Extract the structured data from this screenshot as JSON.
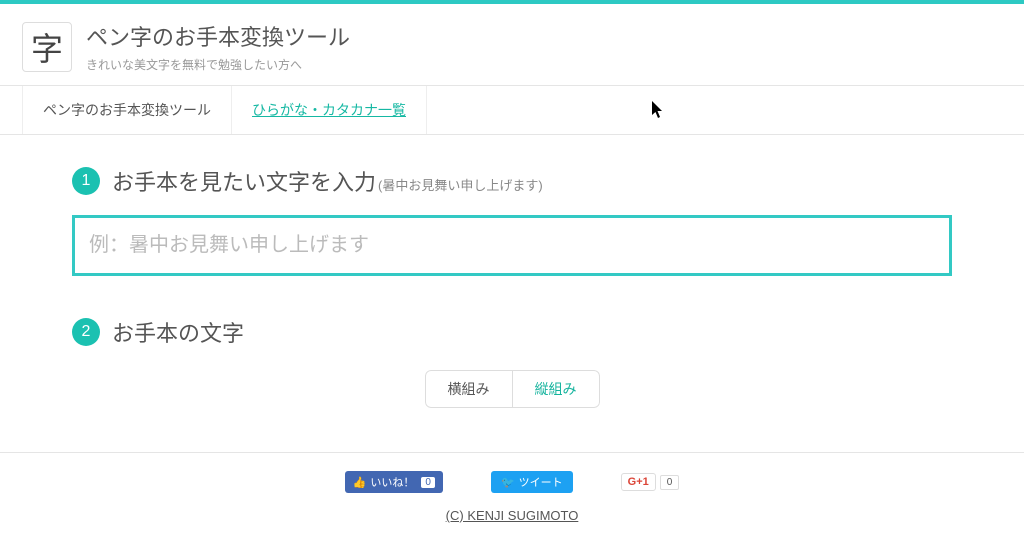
{
  "header": {
    "logo_char": "字",
    "title": "ペン字のお手本変換ツール",
    "subtitle": "きれいな美文字を無料で勉強したい方へ"
  },
  "tabs": [
    {
      "label": "ペン字のお手本変換ツール",
      "active": true
    },
    {
      "label": "ひらがな・カタカナ一覧",
      "link": true
    }
  ],
  "step1": {
    "num": "1",
    "title": "お手本を見たい文字を入力",
    "hint": "(暑中お見舞い申し上げます)",
    "placeholder": "例：暑中お見舞い申し上げます",
    "value": ""
  },
  "step2": {
    "num": "2",
    "title": "お手本の文字"
  },
  "toggle": {
    "horizontal": "横組み",
    "vertical": "縦組み"
  },
  "social": {
    "fb_label": "いいね！",
    "fb_count": "0",
    "tw_label": "ツイート",
    "gp_label": "G+1",
    "gp_count": "0"
  },
  "copyright": "(C) KENJI SUGIMOTO"
}
